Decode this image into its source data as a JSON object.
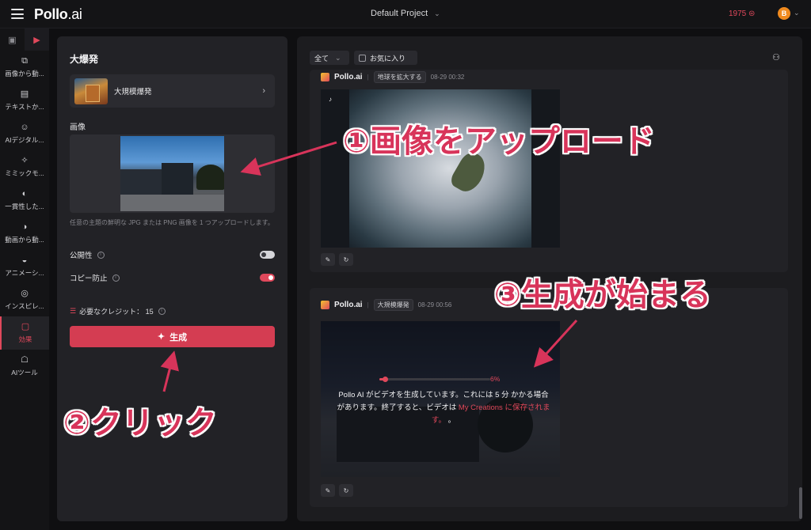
{
  "topbar": {
    "brand": "Pollo",
    "brand_suffix": ".ai",
    "project": "Default Project",
    "credits": "1975",
    "avatar_letter": "B"
  },
  "sidebar": {
    "items": [
      {
        "label": "画像から動...",
        "icon": "image-to-video-icon"
      },
      {
        "label": "テキストか...",
        "icon": "text-to-video-icon"
      },
      {
        "label": "AIデジタル...",
        "icon": "ai-digital-icon"
      },
      {
        "label": "ミミックモ...",
        "icon": "mimic-icon"
      },
      {
        "label": "一貫性した...",
        "icon": "consistency-icon"
      },
      {
        "label": "動画から動...",
        "icon": "video-to-video-icon"
      },
      {
        "label": "アニメーシ...",
        "icon": "animation-icon"
      },
      {
        "label": "インスピレ...",
        "icon": "inspiration-icon"
      },
      {
        "label": "効果",
        "icon": "effects-icon",
        "active": true
      },
      {
        "label": "AIツール",
        "icon": "ai-tools-icon"
      }
    ]
  },
  "left_panel": {
    "title": "大爆発",
    "effect_name": "大規模爆発",
    "image_label": "画像",
    "upload_help": "任意の主題の鮮明な JPG または PNG 画像を 1 つアップロードします。",
    "public_label": "公開性",
    "public_on": false,
    "copy_protect_label": "コピー防止",
    "copy_protect_on": true,
    "credits_required": "必要なクレジット： 15",
    "generate_label": "生成"
  },
  "right_panel": {
    "filter_value": "全て",
    "favorites_label": "お気に入り",
    "card1": {
      "brand": "Pollo.ai",
      "tag": "地球を拡大する",
      "time": "08-29 00:32"
    },
    "card2": {
      "brand": "Pollo.ai",
      "tag": "大規模爆発",
      "time": "08-29 00:56",
      "progress_percent": 6,
      "progress_label": "6%",
      "message_before": "Pollo AI がビデオを生成しています。これには 5 分 かかる場合があります。終了すると、ビデオは ",
      "message_highlight": "My Creations に保存されます。",
      "message_after": " 。"
    }
  },
  "annotations": {
    "step1": "①画像をアップロード",
    "step2": "②クリック",
    "step3": "③生成が始まる"
  },
  "colors": {
    "accent": "#e0485b",
    "annotation": "#d8345a",
    "background": "#0f0f11"
  }
}
